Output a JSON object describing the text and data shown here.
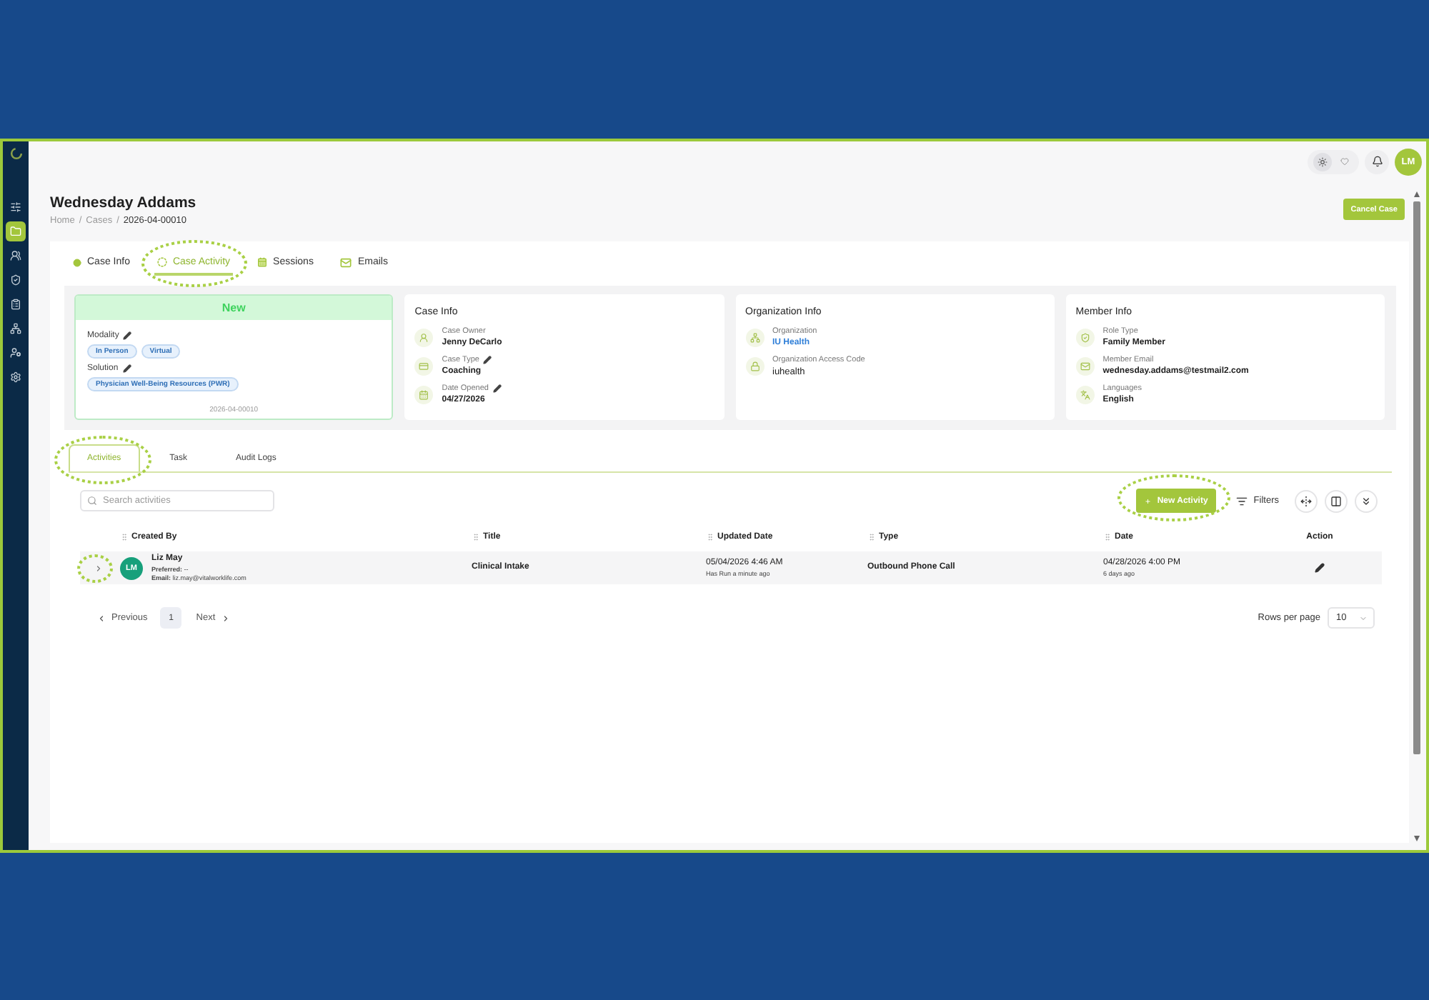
{
  "sidebar": {
    "items": [
      {
        "selected": false
      },
      {
        "selected": true
      },
      {
        "selected": false
      },
      {
        "selected": false
      },
      {
        "selected": false
      },
      {
        "selected": false
      },
      {
        "selected": false
      },
      {
        "selected": false
      }
    ]
  },
  "top_bar": {
    "theme_toggle": [
      {
        "selected": true
      },
      {
        "selected": false
      }
    ],
    "user_initials": "LM"
  },
  "header": {
    "title": "Wednesday Addams",
    "breadcrumb": [
      {
        "kind": "link",
        "text": "Home"
      },
      {
        "kind": "separator",
        "text": "/"
      },
      {
        "kind": "link",
        "text": "Cases"
      },
      {
        "kind": "separator",
        "text": "/"
      },
      {
        "kind": "current",
        "text": "2026-04-00010"
      }
    ],
    "cancel_button": "Cancel Case"
  },
  "tabs": [
    {
      "label": "Case Info",
      "selected": false,
      "highlighted": false
    },
    {
      "label": "Case Activity",
      "selected": true,
      "highlighted": true
    },
    {
      "label": "Sessions",
      "selected": false,
      "highlighted": false
    },
    {
      "label": "Emails",
      "selected": false,
      "highlighted": false
    }
  ],
  "status_card": {
    "status": "New",
    "fields": [
      {
        "label": "Modality",
        "editable": true,
        "chips": [
          "In Person",
          "Virtual"
        ]
      },
      {
        "label": "Solution",
        "editable": true,
        "chips": [
          "Physician Well-Being Resources (PWR)"
        ]
      }
    ],
    "footer": "2026-04-00010"
  },
  "info_cards": [
    {
      "title": "Case Info",
      "fields": [
        {
          "label": "Case Owner",
          "value": "Jenny DeCarlo",
          "kind": "text",
          "editable": false
        },
        {
          "label": "Case Type",
          "value": "Coaching",
          "kind": "text",
          "editable": true
        },
        {
          "label": "Date Opened",
          "value": "04/27/2026",
          "kind": "text",
          "editable": true
        }
      ]
    },
    {
      "title": "Organization Info",
      "fields": [
        {
          "label": "Organization",
          "value": "IU Health",
          "kind": "link",
          "editable": false
        },
        {
          "label": "Organization Access Code",
          "value": "iuhealth",
          "kind": "plain",
          "editable": false
        }
      ]
    },
    {
      "title": "Member Info",
      "fields": [
        {
          "label": "Role Type",
          "value": "Family Member",
          "kind": "text",
          "editable": false
        },
        {
          "label": "Member Email",
          "value": "wednesday.addams@testmail2.com",
          "kind": "text",
          "editable": false
        },
        {
          "label": "Languages",
          "value": "English",
          "kind": "text",
          "editable": false
        }
      ]
    }
  ],
  "activity_tabs": [
    {
      "label": "Activities",
      "selected": true,
      "highlighted": true
    },
    {
      "label": "Task",
      "selected": false,
      "highlighted": false
    },
    {
      "label": "Audit Logs",
      "selected": false,
      "highlighted": false
    }
  ],
  "toolbar": {
    "search": {
      "placeholder": "Search activities"
    },
    "new_activity": {
      "label": "New Activity",
      "highlighted": true
    },
    "filters": "Filters"
  },
  "table": {
    "columns": [
      {
        "label": "Created By",
        "draggable": true
      },
      {
        "label": "Title",
        "draggable": true
      },
      {
        "label": "Updated Date",
        "draggable": true
      },
      {
        "label": "Type",
        "draggable": true
      },
      {
        "label": "Date",
        "draggable": true
      },
      {
        "label": "Action",
        "draggable": false
      }
    ],
    "rows": [
      {
        "expanded": false,
        "highlighted": true,
        "creator": {
          "initials": "LM",
          "name": "Liz May",
          "preferred": "**Preferred:** --",
          "email": "**Email:** liz.may@vitalworklife.com"
        },
        "title": "Clinical Intake",
        "updated": {
          "date": "05/04/2026 4:46 AM",
          "relative": "Has Run a minute ago"
        },
        "type": "Outbound Phone Call",
        "date": {
          "date": "04/28/2026 4:00 PM",
          "relative": "6 days ago"
        }
      }
    ]
  },
  "pagination": {
    "previous": "Previous",
    "pages": [
      {
        "label": "1",
        "selected": true
      }
    ],
    "next": "Next",
    "rows_per_page": {
      "label": "Rows per page",
      "value": "10"
    }
  }
}
